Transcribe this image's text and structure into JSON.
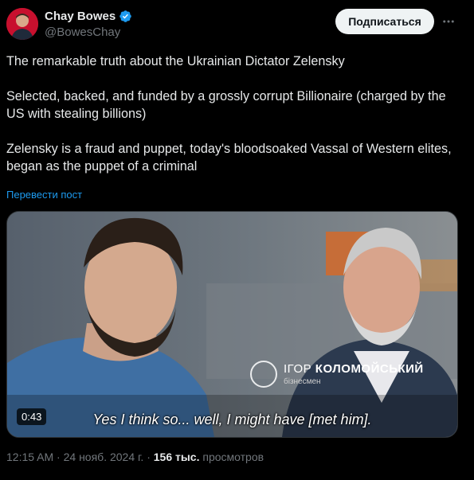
{
  "author": {
    "display_name": "Chay Bowes",
    "handle": "@BowesChay",
    "verified": true,
    "verified_icon": "verified-badge-icon",
    "brand_color": "#1d9bf0"
  },
  "header": {
    "subscribe_label": "Подписаться",
    "more_icon": "more-options-icon"
  },
  "tweet": {
    "paragraphs": [
      "The remarkable truth about the Ukrainian Dictator Zelensky",
      "Selected, backed, and funded by a grossly corrupt Billionaire (charged by the US with stealing billions)",
      "Zelensky is a fraud and puppet, today's bloodsoaked Vassal of Western elites, began as the puppet of a criminal"
    ],
    "translate_label": "Перевести пост"
  },
  "media": {
    "duration": "0:43",
    "caption": "Yes I think so... well, I might have [met him].",
    "lower_third_first": "ІГОР",
    "lower_third_last": "КОЛОМОЙСЬКИЙ",
    "lower_third_role": "бізнесмен"
  },
  "meta": {
    "time": "12:15 AM",
    "separator": "·",
    "date": "24 нояб. 2024 г.",
    "views_count": "156 тыс.",
    "views_label": "просмотров"
  }
}
